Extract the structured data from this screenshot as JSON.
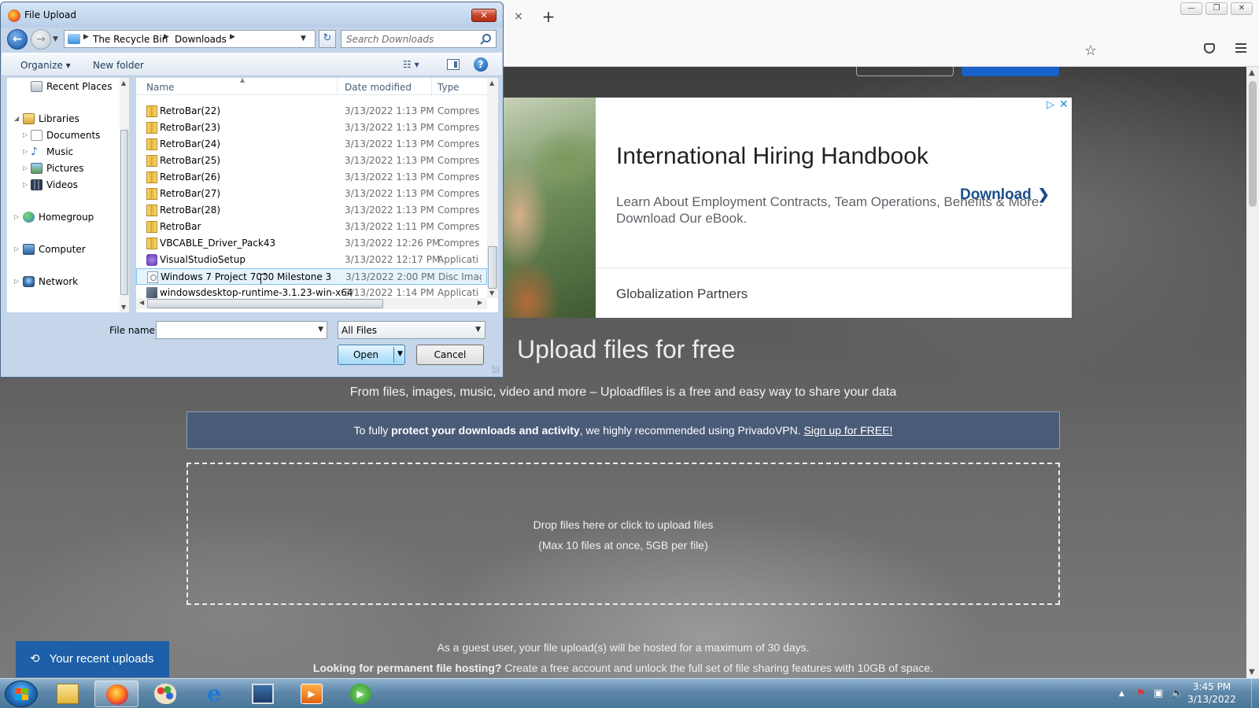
{
  "browser": {
    "tab_close_glyph": "×",
    "new_tab_glyph": "+",
    "window_controls": [
      "—",
      "❐",
      "✕"
    ]
  },
  "ad": {
    "adchoices_glyph": "▷",
    "close_glyph": "✕",
    "title": "International Hiring Handbook",
    "body": "Learn About Employment Contracts, Team Operations, Benefits & More. Download Our eBook.",
    "advertiser": "Globalization Partners",
    "cta": "Download"
  },
  "page": {
    "title": "Upload files for free",
    "subtitle": "From files, images, music, video and more – Uploadfiles is a free and easy way to share your data",
    "vpn_banner": {
      "prefix": "To fully ",
      "bold": "protect your downloads and activity",
      "middle": ", we highly recommended using PrivadoVPN. ",
      "link": "Sign up for FREE!"
    },
    "dropzone_line1": "Drop files here or click to upload files",
    "dropzone_line2": "(Max 10 files at once, 5GB per file)",
    "guest_note": "As a guest user, your file upload(s) will be hosted for a maximum of 30 days.",
    "permanent_note_bold": "Looking for permanent file hosting?",
    "permanent_note_rest": " Create a free account and unlock the full set of file sharing features with 10GB of space.",
    "recent_uploads": "Your recent uploads"
  },
  "dialog": {
    "title": "File Upload",
    "close_glyph": "✕",
    "breadcrumb": [
      "The Recycle Bin",
      "Downloads"
    ],
    "search_placeholder": "Search Downloads",
    "organize": "Organize ▾",
    "new_folder": "New folder",
    "views_glyph": "☷ ▾",
    "help_glyph": "?",
    "nav_items": [
      {
        "label": "Recent Places",
        "icon": "recent-places-icon"
      },
      {
        "label": "Libraries",
        "icon": "libraries-icon"
      },
      {
        "label": "Documents",
        "icon": "documents-icon"
      },
      {
        "label": "Music",
        "icon": "music-icon"
      },
      {
        "label": "Pictures",
        "icon": "pictures-icon"
      },
      {
        "label": "Videos",
        "icon": "videos-icon"
      },
      {
        "label": "Homegroup",
        "icon": "homegroup-icon"
      },
      {
        "label": "Computer",
        "icon": "computer-icon"
      },
      {
        "label": "Network",
        "icon": "network-icon"
      }
    ],
    "columns": {
      "name": "Name",
      "date": "Date modified",
      "type": "Type"
    },
    "files": [
      {
        "name": "RetroBar(22)",
        "date": "3/13/2022 1:13 PM",
        "type": "Compres",
        "icon": "zip"
      },
      {
        "name": "RetroBar(23)",
        "date": "3/13/2022 1:13 PM",
        "type": "Compres",
        "icon": "zip"
      },
      {
        "name": "RetroBar(24)",
        "date": "3/13/2022 1:13 PM",
        "type": "Compres",
        "icon": "zip"
      },
      {
        "name": "RetroBar(25)",
        "date": "3/13/2022 1:13 PM",
        "type": "Compres",
        "icon": "zip"
      },
      {
        "name": "RetroBar(26)",
        "date": "3/13/2022 1:13 PM",
        "type": "Compres",
        "icon": "zip"
      },
      {
        "name": "RetroBar(27)",
        "date": "3/13/2022 1:13 PM",
        "type": "Compres",
        "icon": "zip"
      },
      {
        "name": "RetroBar(28)",
        "date": "3/13/2022 1:13 PM",
        "type": "Compres",
        "icon": "zip"
      },
      {
        "name": "RetroBar",
        "date": "3/13/2022 1:11 PM",
        "type": "Compres",
        "icon": "zip"
      },
      {
        "name": "VBCABLE_Driver_Pack43",
        "date": "3/13/2022 12:26 PM",
        "type": "Compres",
        "icon": "zip"
      },
      {
        "name": "VisualStudioSetup",
        "date": "3/13/2022 12:17 PM",
        "type": "Applicati",
        "icon": "app"
      },
      {
        "name": "Windows 7 Project 7000 Milestone 3",
        "date": "3/13/2022 2:00 PM",
        "type": "Disc Imag",
        "icon": "disc"
      },
      {
        "name": "windowsdesktop-runtime-3.1.23-win-x64",
        "date": "3/13/2022 1:14 PM",
        "type": "Applicati",
        "icon": "installer"
      }
    ],
    "hovered_file_index": 10,
    "filename_label": "File name:",
    "filename_value": "",
    "filetype_value": "All Files",
    "open_label": "Open",
    "cancel_label": "Cancel"
  },
  "taskbar": {
    "clock_time": "3:45 PM",
    "clock_date": "3/13/2022",
    "items": [
      {
        "name": "explorer-taskbar-button",
        "active": false
      },
      {
        "name": "firefox-taskbar-button",
        "active": true
      },
      {
        "name": "paint-taskbar-button",
        "active": false
      },
      {
        "name": "internet-explorer-taskbar-button",
        "active": false
      },
      {
        "name": "remote-desktop-taskbar-button",
        "active": false
      },
      {
        "name": "media-player-taskbar-button",
        "active": false
      },
      {
        "name": "media-center-taskbar-button",
        "active": false
      }
    ]
  },
  "colors": {
    "brand_blue": "#1862c9",
    "vpn_banner_bg": "#4a5b78",
    "recent_uploads_bg": "#1d5fa8",
    "dialog_frame": "#c5d6ea"
  }
}
